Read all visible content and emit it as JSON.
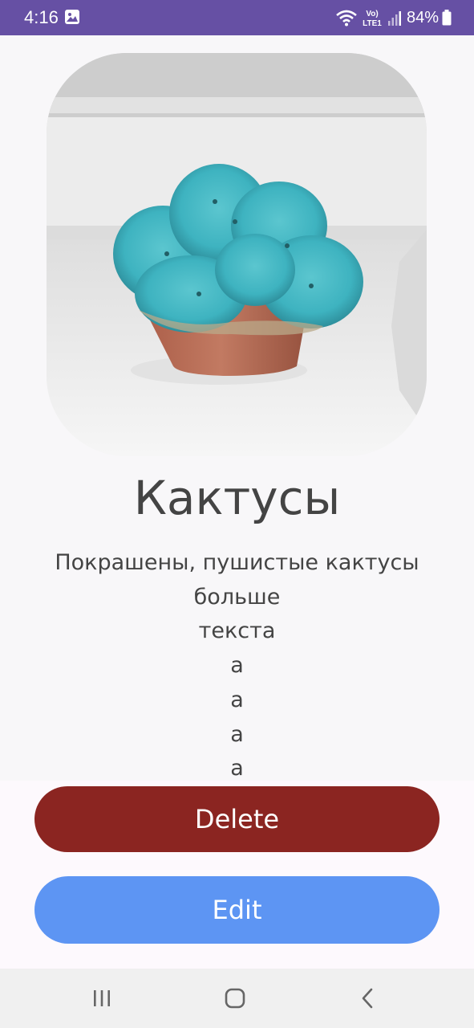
{
  "status_bar": {
    "time": "4:16",
    "battery": "84%",
    "network_label_top": "Vo)",
    "network_label_bottom": "LTE1",
    "background": "#6650a4",
    "icons": [
      "gallery-icon",
      "wifi-icon",
      "signal-icon",
      "battery-icon"
    ]
  },
  "item": {
    "image_icon": "cactus-photo",
    "title": "Кактусы",
    "description_lines": [
      "Покрашены, пушистые кактусы",
      "больше",
      "текста",
      "а",
      "а",
      "а",
      "а"
    ]
  },
  "actions": {
    "delete_label": "Delete",
    "delete_color": "#8b2521",
    "edit_label": "Edit",
    "edit_color": "#5d95f3"
  },
  "nav_bar": {
    "icons": [
      "recent-apps-icon",
      "home-icon",
      "back-icon"
    ]
  }
}
